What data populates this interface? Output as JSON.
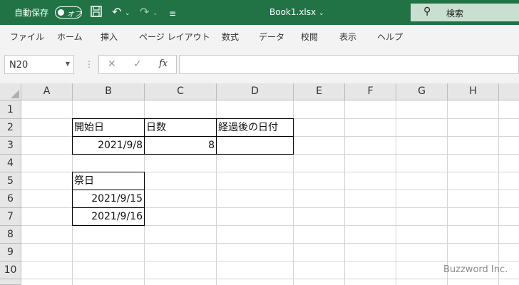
{
  "titlebar": {
    "autosave_label": "自動保存",
    "autosave_state": "オフ",
    "file_title": "Book1.xlsx",
    "title_caret": "⌄",
    "search_label": "検索"
  },
  "ribbon": {
    "tabs": [
      "ファイル",
      "ホーム",
      "挿入",
      "ページ レイアウト",
      "数式",
      "データ",
      "校閲",
      "表示",
      "ヘルプ"
    ]
  },
  "formula_bar": {
    "name_box": "N20",
    "formula": ""
  },
  "sheet": {
    "columns": [
      "A",
      "B",
      "C",
      "D",
      "E",
      "F",
      "G",
      "H"
    ],
    "rows": [
      "1",
      "2",
      "3",
      "4",
      "5",
      "6",
      "7",
      "8",
      "9",
      "10"
    ],
    "cells": {
      "B2": "開始日",
      "C2": "日数",
      "D2": "経過後の日付",
      "B3": "2021/9/8",
      "C3": "8",
      "D3": "",
      "B5": "祭日",
      "B6": "2021/9/15",
      "B7": "2021/9/16"
    }
  },
  "watermark": "Buzzword Inc.",
  "colors": {
    "accent": "#217346",
    "search_bg": "#c9dfcf"
  }
}
